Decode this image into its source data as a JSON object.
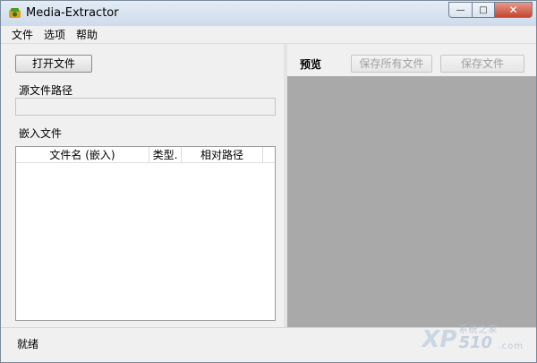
{
  "window": {
    "title": "Media-Extractor",
    "buttons": {
      "minimize": "—",
      "maximize": "□",
      "close": "✕"
    }
  },
  "menu": {
    "items": [
      {
        "label": "文件"
      },
      {
        "label": "选项"
      },
      {
        "label": "帮助"
      }
    ]
  },
  "left": {
    "open_button": "打开文件",
    "source_label": "源文件路径",
    "source_value": "",
    "embedded_label": "嵌入文件",
    "columns": [
      "文件名 (嵌入)",
      "类型.",
      "相对路径"
    ]
  },
  "right": {
    "preview_label": "预览",
    "save_all_button": "保存所有文件",
    "save_button": "保存文件"
  },
  "status": {
    "text": "就绪"
  },
  "watermark": {
    "top": "系统之家",
    "number": "510",
    "prefix": "XP",
    "suffix": ".com"
  },
  "colors": {
    "preview_bg": "#a9a9a9",
    "window_bg": "#f0f0f0",
    "close_red": "#c4452d"
  }
}
